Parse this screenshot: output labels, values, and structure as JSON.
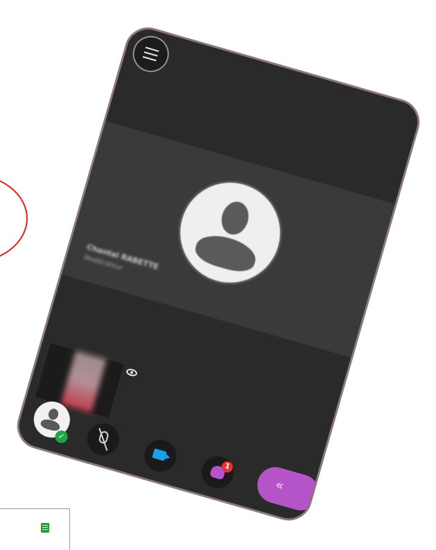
{
  "participant": {
    "name": "Chantal RABETTE",
    "role": "Modérateur"
  },
  "toolbar": {
    "users_badge_count": "1",
    "self_status": "✓",
    "chevron_label": "«"
  },
  "icons": {
    "menu": "menu-icon",
    "avatar": "user-avatar-icon",
    "eye": "eye-icon",
    "mic_off": "mic-off-icon",
    "camera": "camera-icon",
    "users": "users-icon",
    "chevron": "double-chevron-left-icon",
    "document": "document-icon"
  },
  "colors": {
    "phone_bg": "#2a2a2a",
    "phone_border": "#8c7a76",
    "tile_bg": "#3a3a3a",
    "accent_purple": "#b553c8",
    "camera_blue": "#1aa0e8",
    "status_green": "#22a54a",
    "badge_red": "#e3343a",
    "annotation_red": "#e0201a"
  }
}
